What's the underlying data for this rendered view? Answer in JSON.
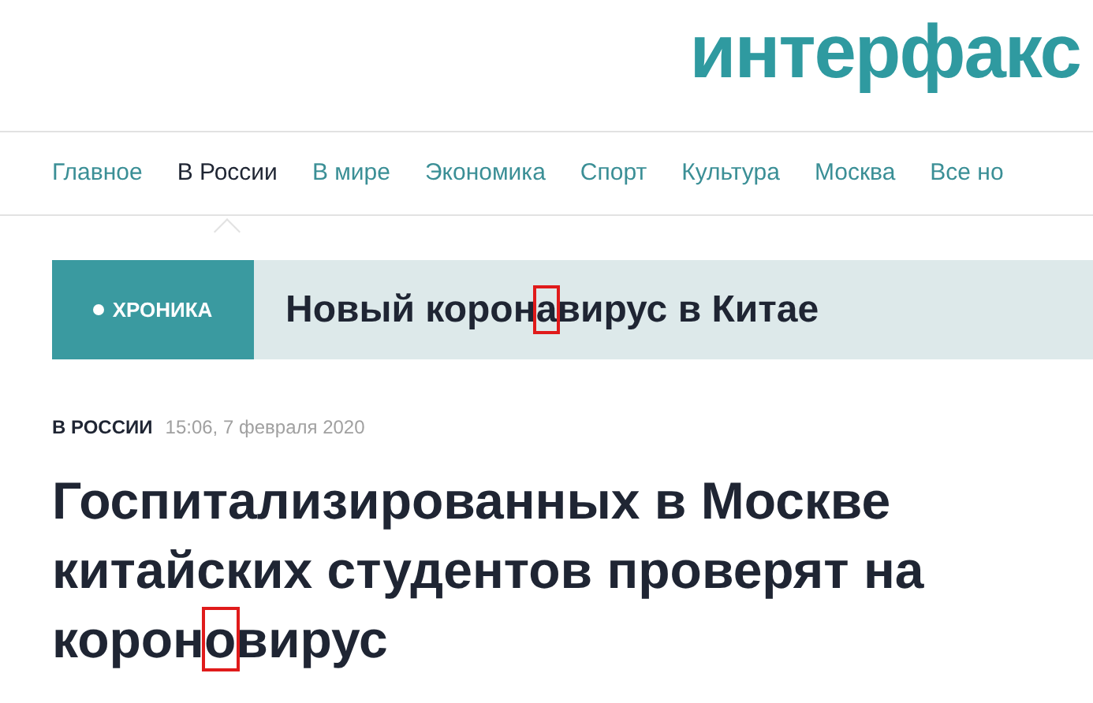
{
  "logo": "интерфакс",
  "nav": [
    {
      "label": "Главное",
      "selected": false
    },
    {
      "label": "В России",
      "selected": true
    },
    {
      "label": "В мире",
      "selected": false
    },
    {
      "label": "Экономика",
      "selected": false
    },
    {
      "label": "Спорт",
      "selected": false
    },
    {
      "label": "Культура",
      "selected": false
    },
    {
      "label": "Москва",
      "selected": false
    },
    {
      "label": "Все но",
      "selected": false
    }
  ],
  "banner": {
    "tag": "ХРОНИКА",
    "title": {
      "before": "Новый корон",
      "marked": "а",
      "after": "вирус в Китае"
    }
  },
  "article": {
    "section": "В РОССИИ",
    "time": "15:06, 7 февраля 2020",
    "headline": {
      "before": "Госпитализированных в Москве китайских студентов проверят на корон",
      "marked": "о",
      "after": "вирус"
    }
  }
}
